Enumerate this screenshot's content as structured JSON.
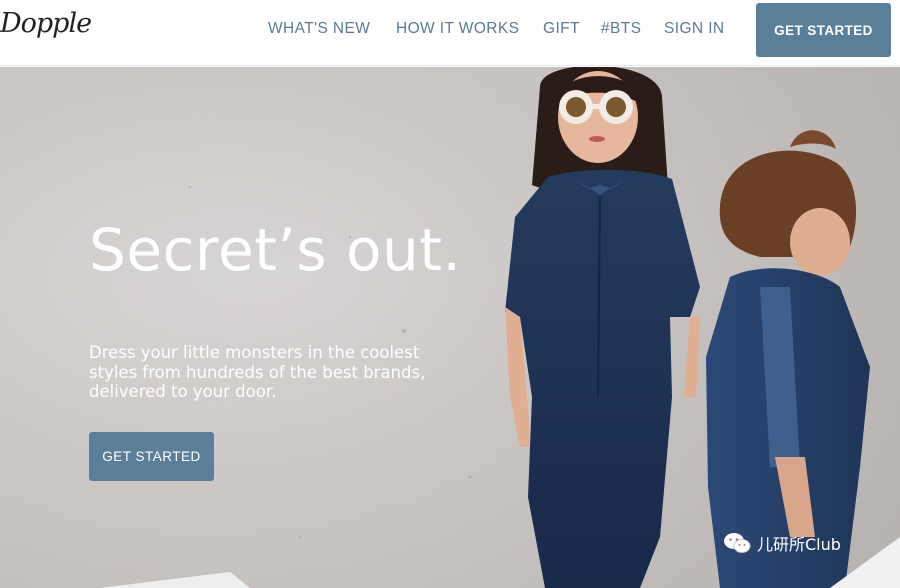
{
  "header": {
    "logo_text": "Dopple",
    "nav": [
      {
        "label": "WHAT'S NEW"
      },
      {
        "label": "HOW IT WORKS"
      },
      {
        "label": "GIFT"
      },
      {
        "label": "#BTS"
      },
      {
        "label": "SIGN IN"
      }
    ],
    "cta_label": "GET STARTED"
  },
  "hero": {
    "headline": "Secret’s out.",
    "subtext": "Dress your little monsters in the coolest styles from hundreds of the best brands, delivered to your door.",
    "cta_label": "GET STARTED"
  },
  "watermark": {
    "text": "儿研所Club"
  },
  "colors": {
    "accent": "#5b7e99",
    "nav_text": "#5c7a93",
    "hero_wall": "#ccc8c6",
    "denim": "#1f3556"
  }
}
